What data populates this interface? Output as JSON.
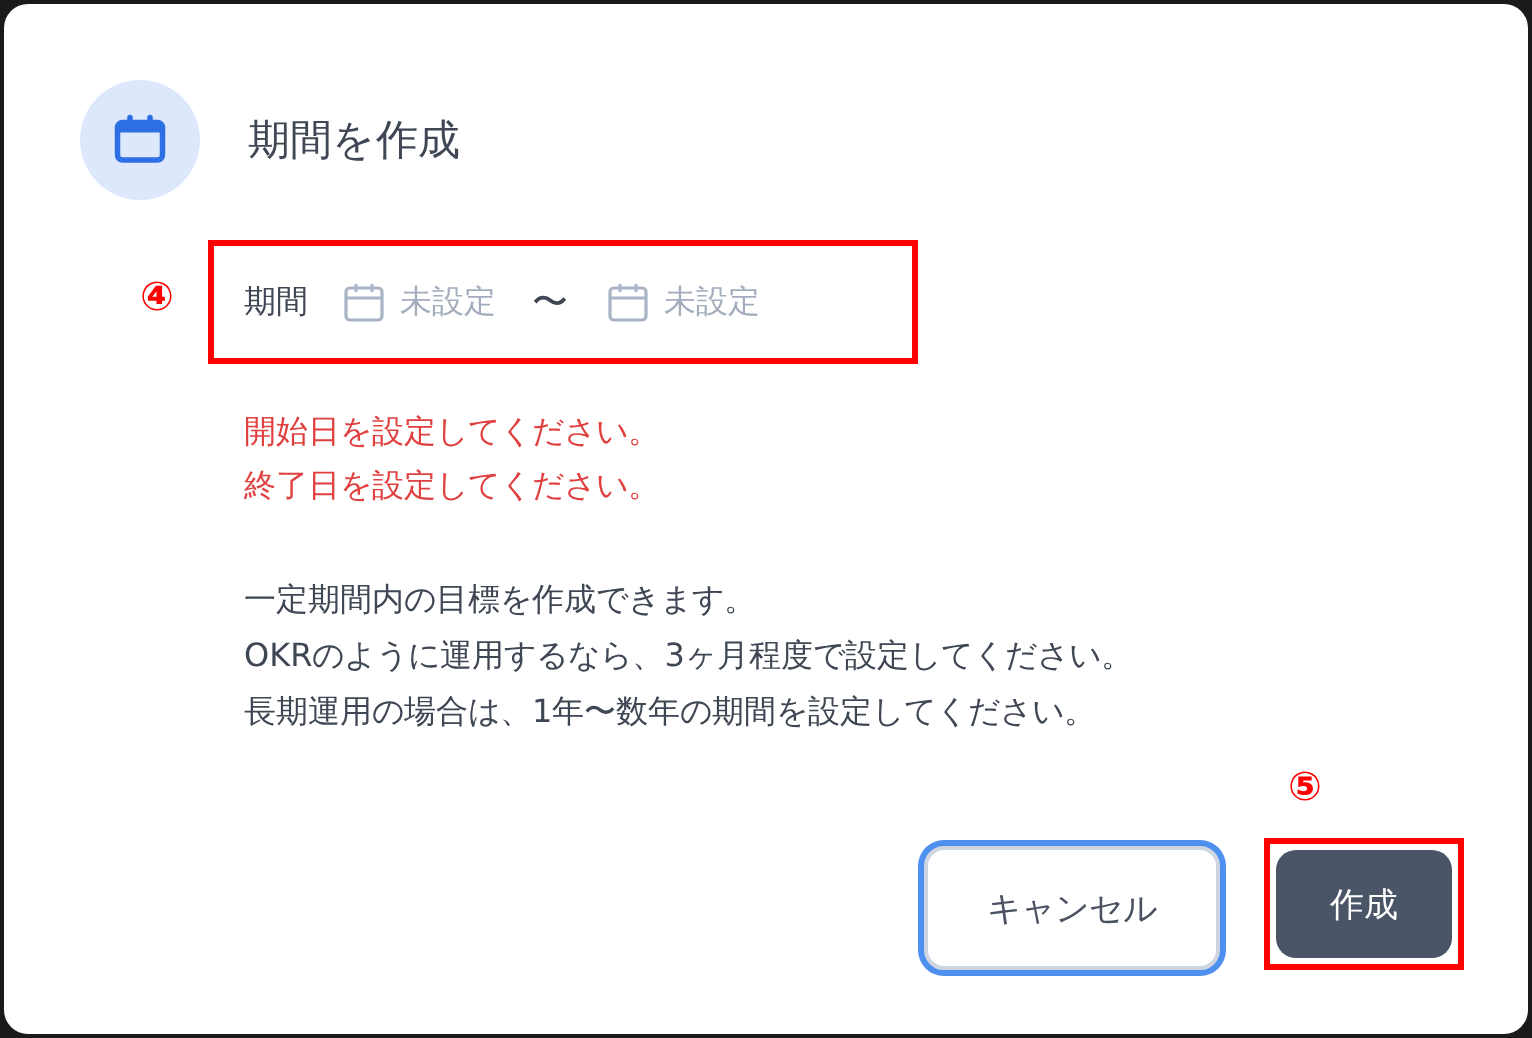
{
  "dialog": {
    "title": "期間を作成",
    "period": {
      "label": "期間",
      "start_placeholder": "未設定",
      "separator": "〜",
      "end_placeholder": "未設定",
      "annotation": "④"
    },
    "errors": [
      "開始日を設定してください。",
      "終了日を設定してください。"
    ],
    "description": [
      "一定期間内の目標を作成できます。",
      "OKRのように運用するなら、3ヶ月程度で設定してください。",
      "長期運用の場合は、1年〜数年の期間を設定してください。"
    ],
    "buttons": [
      {
        "label": "キャンセル",
        "kind": "secondary",
        "focused": true
      },
      {
        "label": "作成",
        "kind": "primary",
        "focused": false,
        "annotation": "⑤"
      }
    ]
  }
}
